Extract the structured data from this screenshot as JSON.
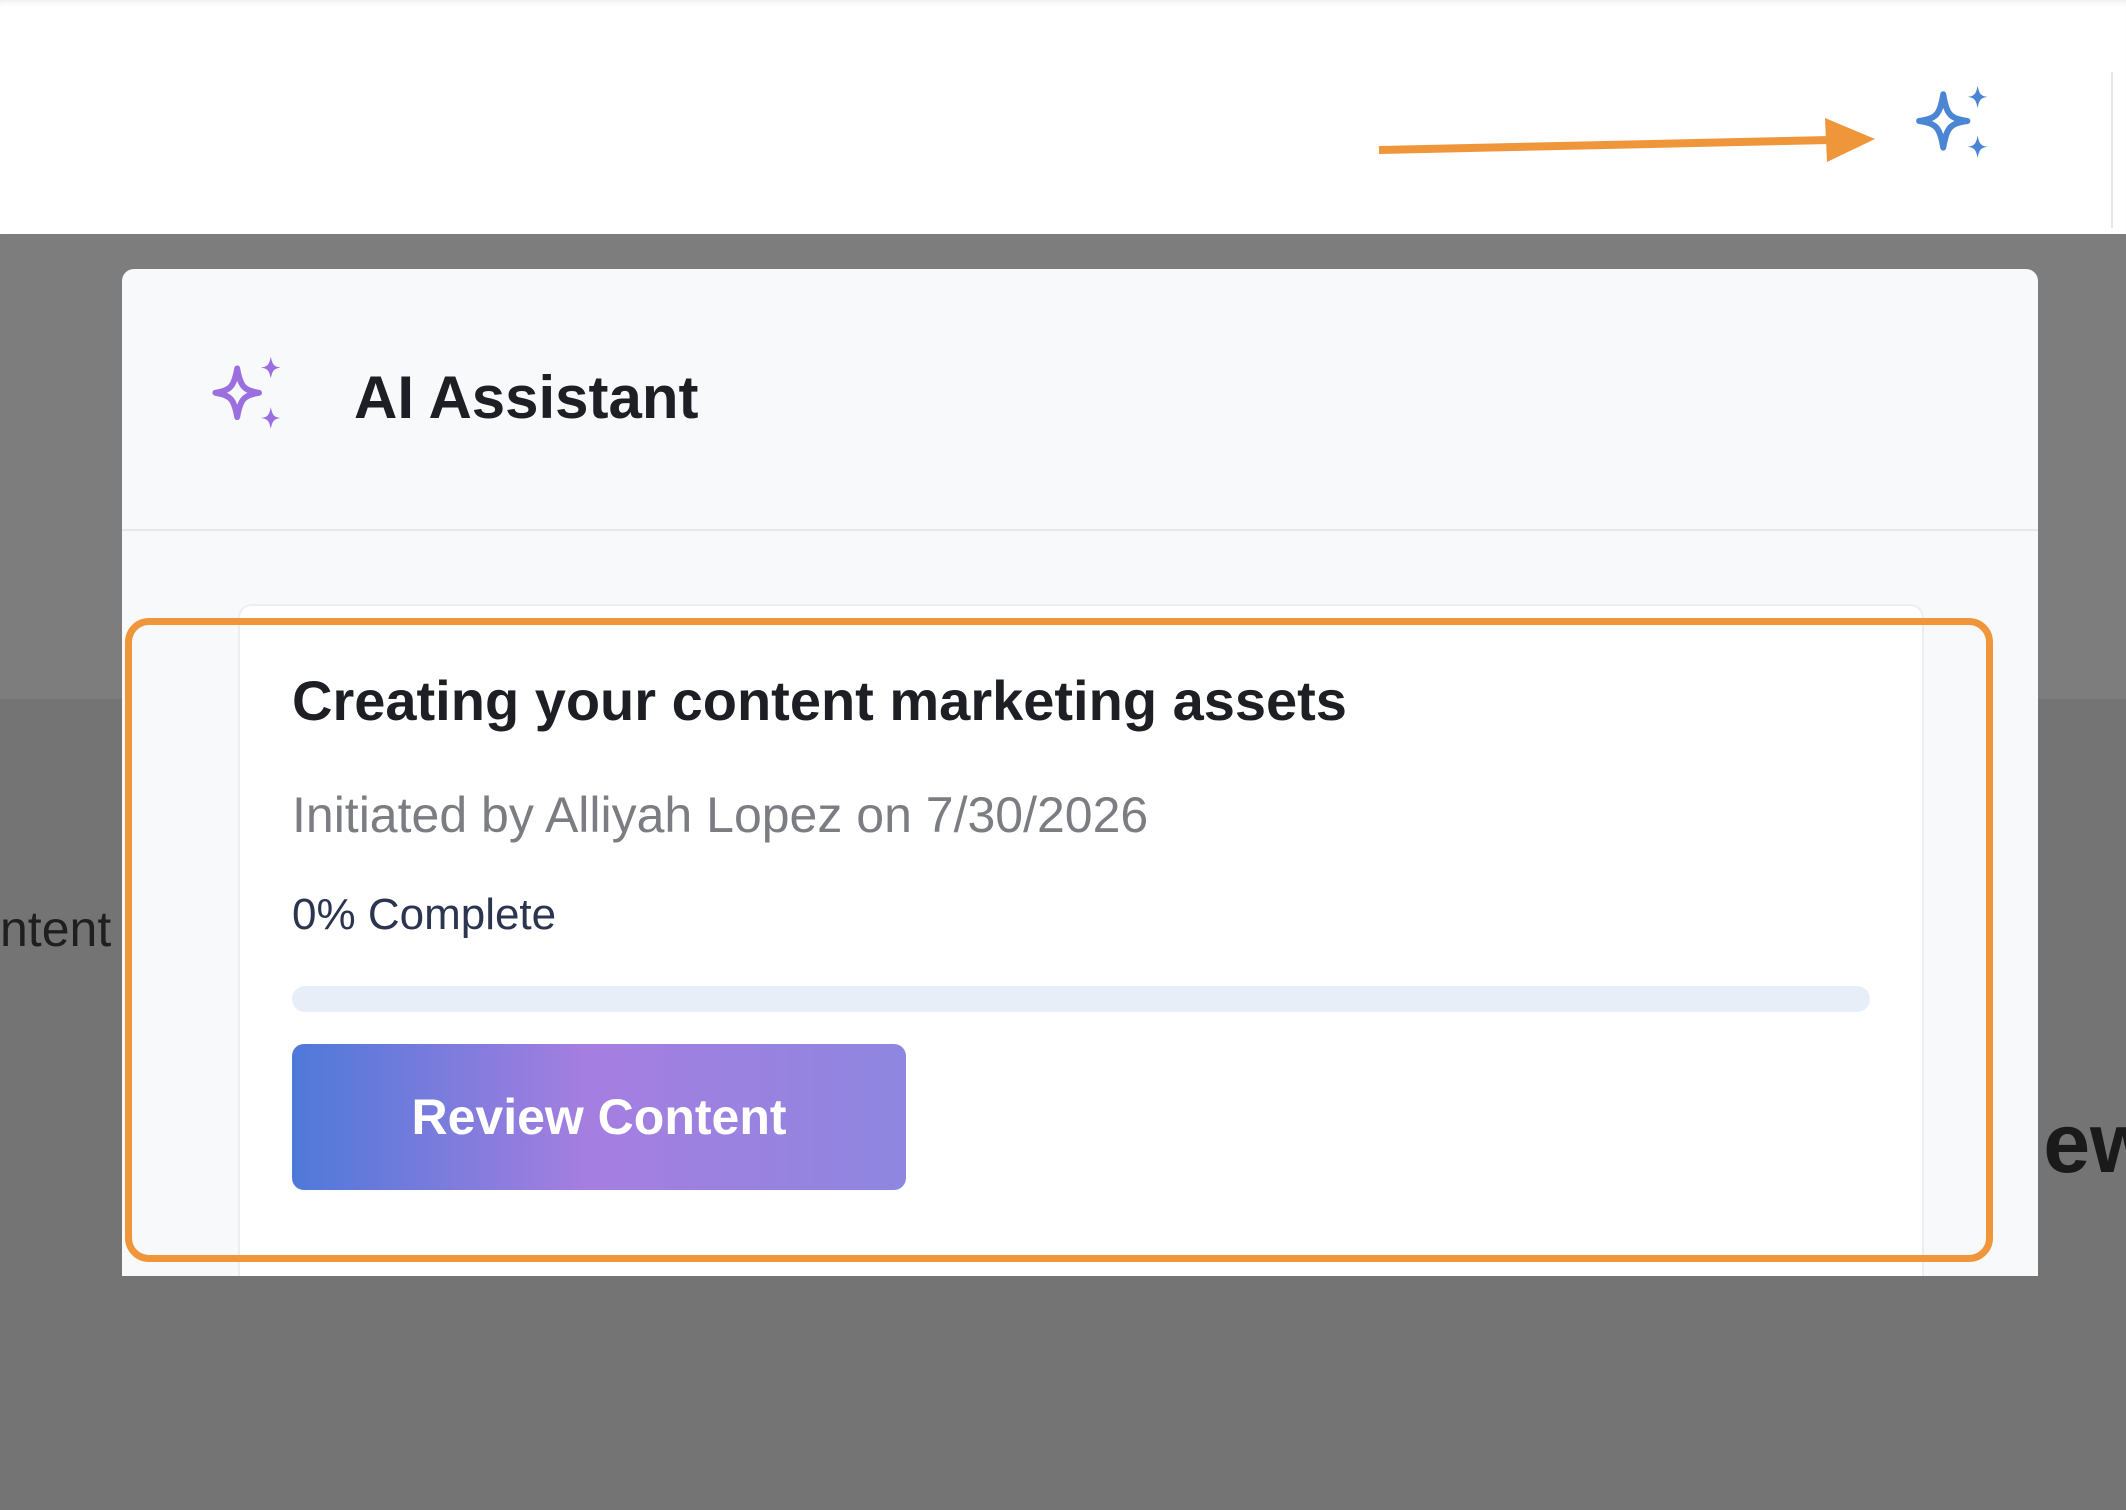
{
  "background": {
    "left_text": "ntent",
    "right_text": "iew"
  },
  "ai_assistant": {
    "trigger_icon": "sparkles-icon",
    "trigger_color": "#4a86d4",
    "panel_title": "AI Assistant",
    "panel_icon": "sparkles-icon",
    "panel_icon_color": "#9b6fe0",
    "task": {
      "title": "Creating your content marketing assets",
      "meta": "Initiated by Alliyah Lopez on 7/30/2026",
      "progress_label": "0% Complete",
      "progress_percent": 0,
      "action_label": "Review Content"
    }
  },
  "annotations": {
    "arrow_color": "#f0963a",
    "highlight_color": "#f0963a"
  }
}
